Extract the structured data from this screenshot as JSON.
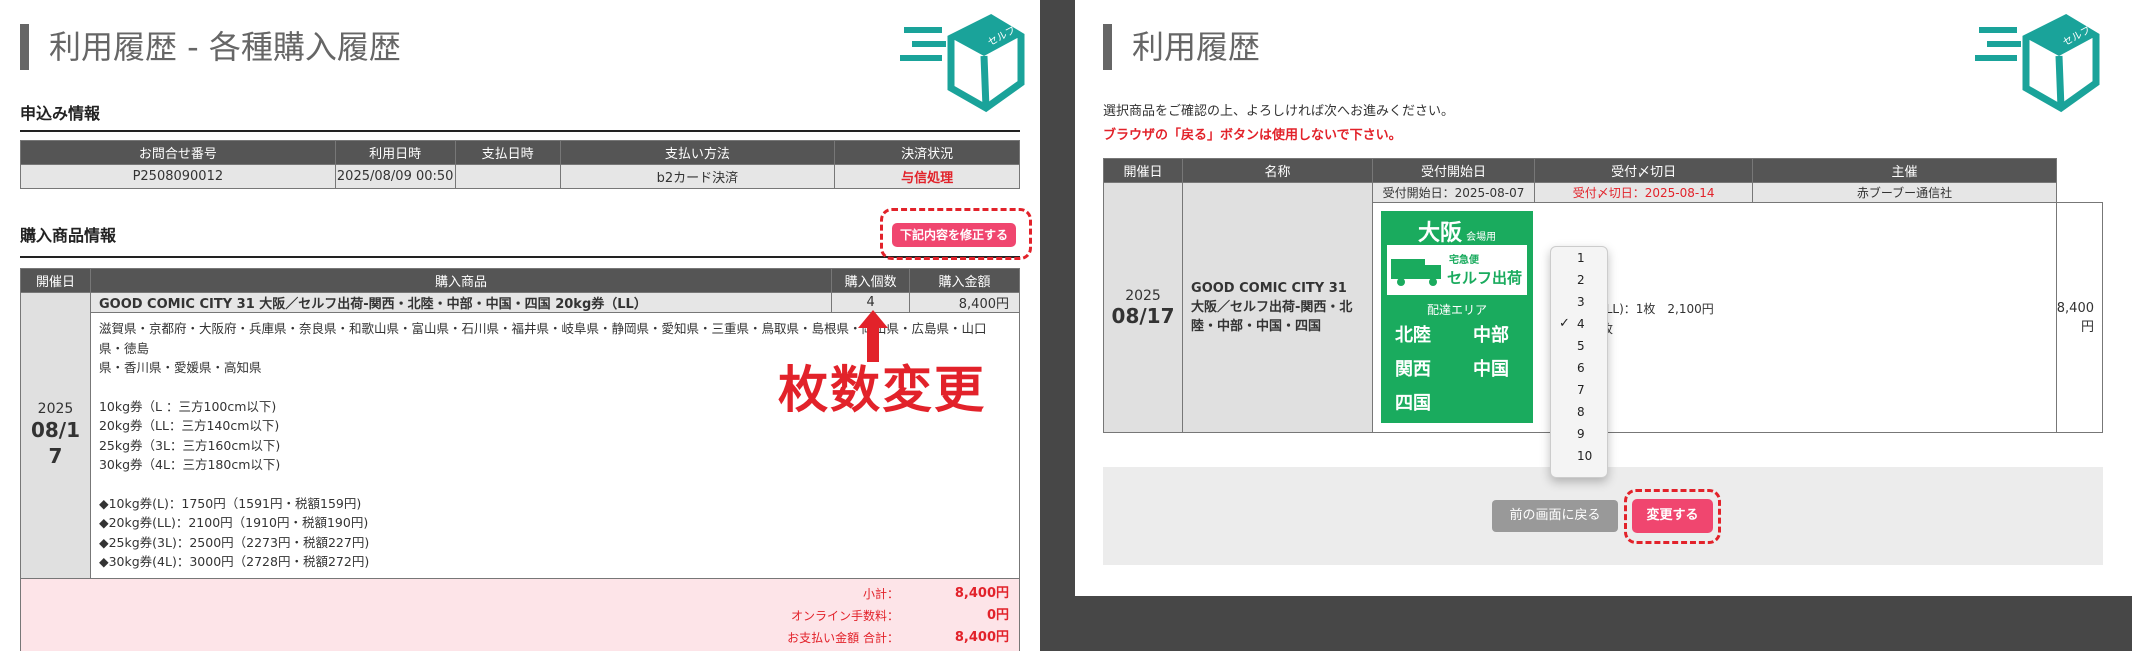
{
  "left": {
    "title": "利用履歴 - 各種購入履歴",
    "application_section": "申込み情報",
    "app_headers": [
      "お問合せ番号",
      "利用日時",
      "支払日時",
      "支払い方法",
      "決済状況"
    ],
    "app_row": [
      "P2508090012",
      "2025/08/09 00:50",
      "",
      "b2カード決済",
      "与信処理"
    ],
    "products_section": "購入商品情報",
    "edit_button": "下記内容を修正する",
    "prod_headers": [
      "開催日",
      "購入商品",
      "購入個数",
      "購入金額"
    ],
    "event_year": "2025",
    "event_date_lines": [
      "08/1",
      "7"
    ],
    "product_name": "GOOD COMIC CITY 31 大阪／セルフ出荷-関西・北陸・中部・中国・四国 20kg券（LL）",
    "quantity": "4",
    "amount": "8,400円",
    "description_lines": [
      "滋賀県・京都府・大阪府・兵庫県・奈良県・和歌山県・富山県・石川県・福井県・岐阜県・静岡県・愛知県・三重県・鳥取県・島根県・岡山県・広島県・山口県・徳島",
      "県・香川県・愛媛県・高知県",
      "",
      "10kg券（L ：三方100cm以下)",
      "20kg券（LL：三方140cm以下)",
      "25kg券（3L：三方160cm以下)",
      "30kg券（4L：三方180cm以下)",
      "",
      "◆10kg券(L)：1750円（1591円・税額159円)",
      "◆20kg券(LL)：2100円（1910円・税額190円)",
      "◆25kg券(3L)：2500円（2273円・税額227円)",
      "◆30kg券(4L)：3000円（2728円・税額272円)"
    ],
    "subtotal_label": "小計：",
    "subtotal_value": "8,400円",
    "fee_label": "オンライン手数料：",
    "fee_value": "0円",
    "total_label": "お支払い金額 合計：",
    "total_value": "8,400円",
    "annotation": "枚数変更"
  },
  "right": {
    "title": "利用履歴",
    "instruction": "選択商品をご確認の上、よろしければ次へお進みください。",
    "warning": "ブラウザの「戻る」ボタンは使用しないで下さい。",
    "headers": [
      "開催日",
      "名称",
      "受付開始日",
      "受付〆切日",
      "主催"
    ],
    "start_date": "受付開始日：2025-08-07",
    "end_date": "受付〆切日：2025-08-14",
    "organizer": "赤ブーブー通信社",
    "event_year": "2025",
    "event_date": "08/17",
    "event_name": "GOOD COMIC CITY 31 大阪／セルフ出荷-関西・北陸・中部・中国・四国",
    "item_line1": "(LL)：1枚　2,100円",
    "item_line2": "枚",
    "amount": "8,400円",
    "back_button": "前の画面に戻る",
    "change_button": "変更する",
    "qty_options": [
      "1",
      "2",
      "3",
      "4",
      "5",
      "6",
      "7",
      "8",
      "9",
      "10"
    ],
    "qty_selected": "4",
    "banner": {
      "city": "大阪",
      "venue": "会場用",
      "service_small": "宅急便",
      "service": "セルフ出荷",
      "area_label": "配達エリア",
      "regions": [
        "北陸",
        "中部",
        "関西",
        "中国",
        "四国"
      ]
    }
  },
  "logo_text": "セルフ"
}
